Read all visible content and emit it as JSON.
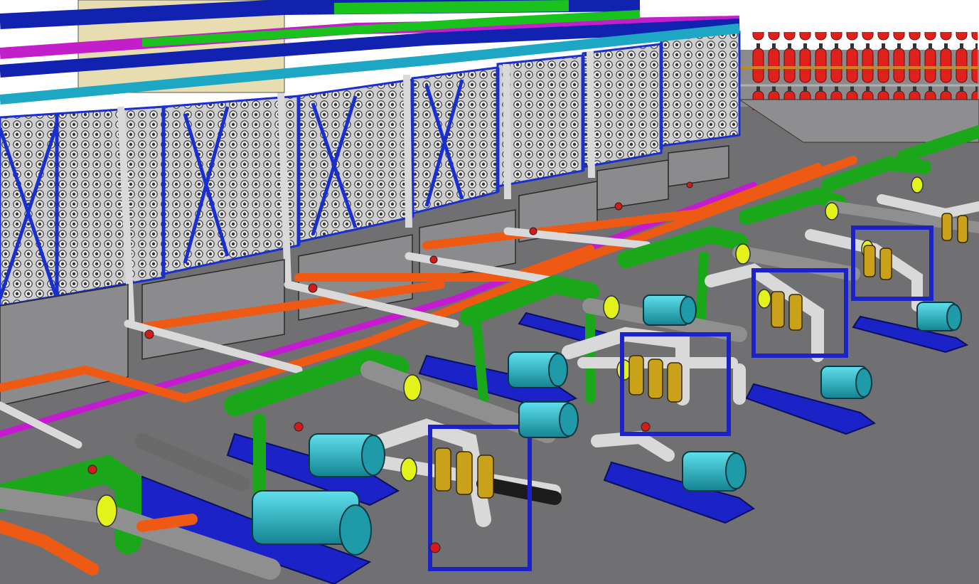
{
  "image": {
    "kind": "3D plant layout rendering",
    "colors": {
      "floor": "#6f6f70",
      "plinth": "#8b8b8d",
      "rack_frame": "#1a2fd0",
      "membrane": "#dedede",
      "membrane_end": "#3a3a3a",
      "header_cyan": "#1da7c4",
      "header_blue": "#1122b0",
      "header_green": "#19c21c",
      "header_magenta": "#c21fcb",
      "pipe_green": "#1aa81a",
      "pipe_orange": "#ee5a14",
      "pipe_magenta": "#c41bd0",
      "pipe_white": "#d9d9d9",
      "pump_skid": "#1a22c8",
      "motor": "#24b3c2",
      "flange_yellow": "#e4f21c",
      "filter_gold": "#c9a21a",
      "vessel_red": "#e0201a",
      "tank_cream": "#e8ddb0"
    }
  }
}
